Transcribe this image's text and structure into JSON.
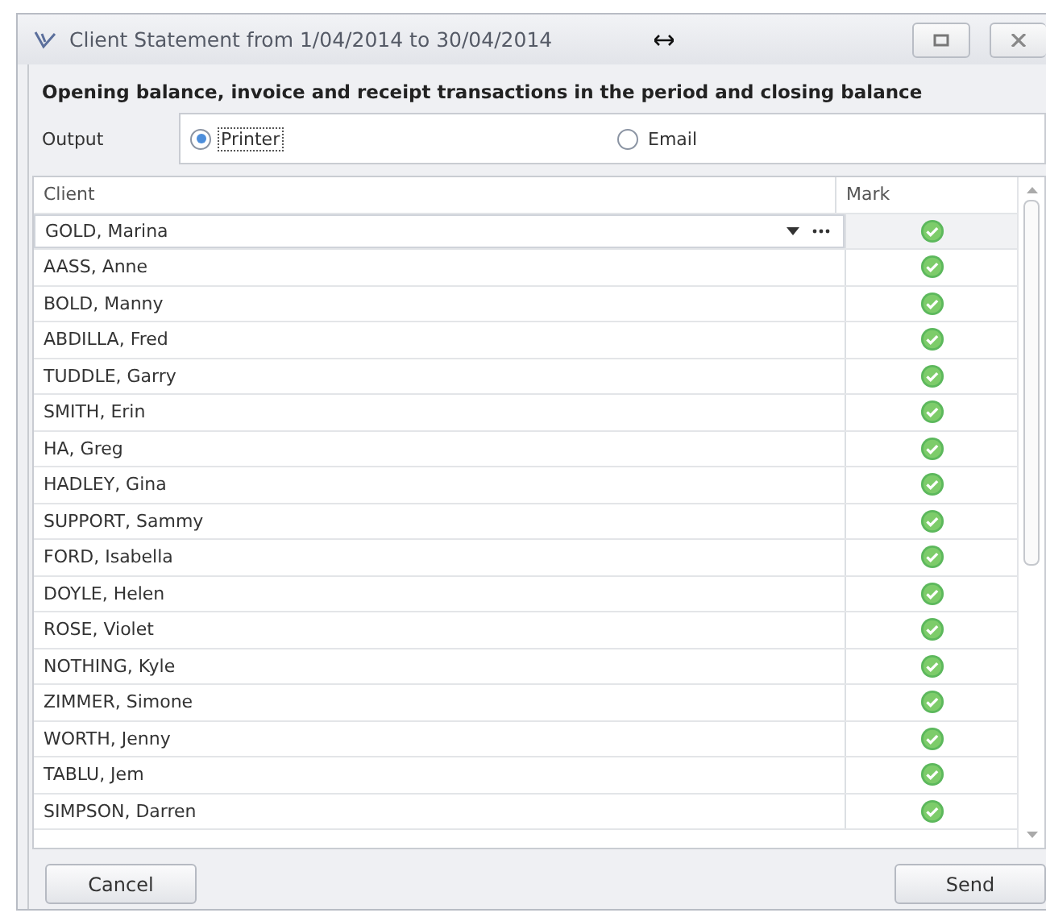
{
  "window": {
    "title": "Client Statement from 1/04/2014 to 30/04/2014"
  },
  "heading": "Opening balance, invoice and receipt transactions in the period and closing balance",
  "output": {
    "label": "Output",
    "options": [
      {
        "label": "Printer",
        "selected": true
      },
      {
        "label": "Email",
        "selected": false
      }
    ]
  },
  "table": {
    "columns": [
      "Client",
      "Mark"
    ],
    "rows": [
      {
        "client": "GOLD, Marina",
        "checked": true,
        "selected": true
      },
      {
        "client": "AASS, Anne",
        "checked": true,
        "selected": false
      },
      {
        "client": "BOLD, Manny",
        "checked": true,
        "selected": false
      },
      {
        "client": "ABDILLA, Fred",
        "checked": true,
        "selected": false
      },
      {
        "client": "TUDDLE, Garry",
        "checked": true,
        "selected": false
      },
      {
        "client": "SMITH, Erin",
        "checked": true,
        "selected": false
      },
      {
        "client": "HA, Greg",
        "checked": true,
        "selected": false
      },
      {
        "client": "HADLEY, Gina",
        "checked": true,
        "selected": false
      },
      {
        "client": "SUPPORT, Sammy",
        "checked": true,
        "selected": false
      },
      {
        "client": "FORD, Isabella",
        "checked": true,
        "selected": false
      },
      {
        "client": "DOYLE, Helen",
        "checked": true,
        "selected": false
      },
      {
        "client": "ROSE, Violet",
        "checked": true,
        "selected": false
      },
      {
        "client": "NOTHING, Kyle",
        "checked": true,
        "selected": false
      },
      {
        "client": "ZIMMER, Simone",
        "checked": true,
        "selected": false
      },
      {
        "client": "WORTH, Jenny",
        "checked": true,
        "selected": false
      },
      {
        "client": "TABLU, Jem",
        "checked": true,
        "selected": false
      },
      {
        "client": "SIMPSON, Darren",
        "checked": true,
        "selected": false
      }
    ]
  },
  "buttons": [
    {
      "label": "Cancel"
    },
    {
      "label": "Send"
    }
  ]
}
